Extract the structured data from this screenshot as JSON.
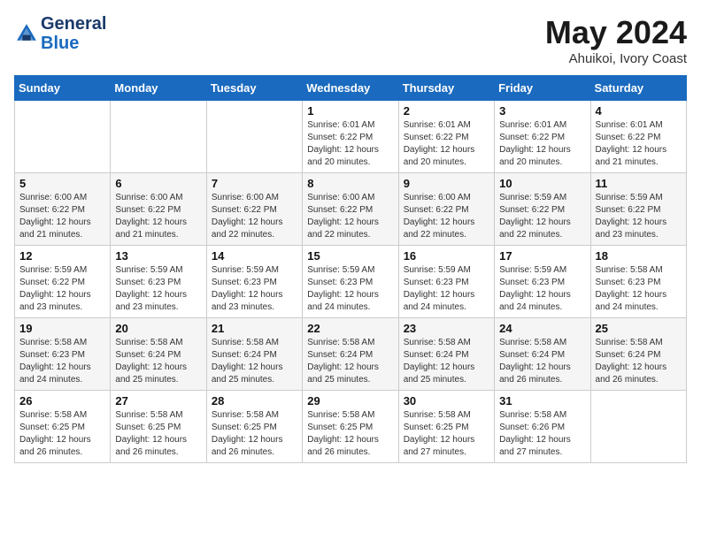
{
  "header": {
    "logo_line1": "General",
    "logo_line2": "Blue",
    "month_title": "May 2024",
    "location": "Ahuikoi, Ivory Coast"
  },
  "weekdays": [
    "Sunday",
    "Monday",
    "Tuesday",
    "Wednesday",
    "Thursday",
    "Friday",
    "Saturday"
  ],
  "weeks": [
    [
      {
        "day": "",
        "info": ""
      },
      {
        "day": "",
        "info": ""
      },
      {
        "day": "",
        "info": ""
      },
      {
        "day": "1",
        "info": "Sunrise: 6:01 AM\nSunset: 6:22 PM\nDaylight: 12 hours\nand 20 minutes."
      },
      {
        "day": "2",
        "info": "Sunrise: 6:01 AM\nSunset: 6:22 PM\nDaylight: 12 hours\nand 20 minutes."
      },
      {
        "day": "3",
        "info": "Sunrise: 6:01 AM\nSunset: 6:22 PM\nDaylight: 12 hours\nand 20 minutes."
      },
      {
        "day": "4",
        "info": "Sunrise: 6:01 AM\nSunset: 6:22 PM\nDaylight: 12 hours\nand 21 minutes."
      }
    ],
    [
      {
        "day": "5",
        "info": "Sunrise: 6:00 AM\nSunset: 6:22 PM\nDaylight: 12 hours\nand 21 minutes."
      },
      {
        "day": "6",
        "info": "Sunrise: 6:00 AM\nSunset: 6:22 PM\nDaylight: 12 hours\nand 21 minutes."
      },
      {
        "day": "7",
        "info": "Sunrise: 6:00 AM\nSunset: 6:22 PM\nDaylight: 12 hours\nand 22 minutes."
      },
      {
        "day": "8",
        "info": "Sunrise: 6:00 AM\nSunset: 6:22 PM\nDaylight: 12 hours\nand 22 minutes."
      },
      {
        "day": "9",
        "info": "Sunrise: 6:00 AM\nSunset: 6:22 PM\nDaylight: 12 hours\nand 22 minutes."
      },
      {
        "day": "10",
        "info": "Sunrise: 5:59 AM\nSunset: 6:22 PM\nDaylight: 12 hours\nand 22 minutes."
      },
      {
        "day": "11",
        "info": "Sunrise: 5:59 AM\nSunset: 6:22 PM\nDaylight: 12 hours\nand 23 minutes."
      }
    ],
    [
      {
        "day": "12",
        "info": "Sunrise: 5:59 AM\nSunset: 6:22 PM\nDaylight: 12 hours\nand 23 minutes."
      },
      {
        "day": "13",
        "info": "Sunrise: 5:59 AM\nSunset: 6:23 PM\nDaylight: 12 hours\nand 23 minutes."
      },
      {
        "day": "14",
        "info": "Sunrise: 5:59 AM\nSunset: 6:23 PM\nDaylight: 12 hours\nand 23 minutes."
      },
      {
        "day": "15",
        "info": "Sunrise: 5:59 AM\nSunset: 6:23 PM\nDaylight: 12 hours\nand 24 minutes."
      },
      {
        "day": "16",
        "info": "Sunrise: 5:59 AM\nSunset: 6:23 PM\nDaylight: 12 hours\nand 24 minutes."
      },
      {
        "day": "17",
        "info": "Sunrise: 5:59 AM\nSunset: 6:23 PM\nDaylight: 12 hours\nand 24 minutes."
      },
      {
        "day": "18",
        "info": "Sunrise: 5:58 AM\nSunset: 6:23 PM\nDaylight: 12 hours\nand 24 minutes."
      }
    ],
    [
      {
        "day": "19",
        "info": "Sunrise: 5:58 AM\nSunset: 6:23 PM\nDaylight: 12 hours\nand 24 minutes."
      },
      {
        "day": "20",
        "info": "Sunrise: 5:58 AM\nSunset: 6:24 PM\nDaylight: 12 hours\nand 25 minutes."
      },
      {
        "day": "21",
        "info": "Sunrise: 5:58 AM\nSunset: 6:24 PM\nDaylight: 12 hours\nand 25 minutes."
      },
      {
        "day": "22",
        "info": "Sunrise: 5:58 AM\nSunset: 6:24 PM\nDaylight: 12 hours\nand 25 minutes."
      },
      {
        "day": "23",
        "info": "Sunrise: 5:58 AM\nSunset: 6:24 PM\nDaylight: 12 hours\nand 25 minutes."
      },
      {
        "day": "24",
        "info": "Sunrise: 5:58 AM\nSunset: 6:24 PM\nDaylight: 12 hours\nand 26 minutes."
      },
      {
        "day": "25",
        "info": "Sunrise: 5:58 AM\nSunset: 6:24 PM\nDaylight: 12 hours\nand 26 minutes."
      }
    ],
    [
      {
        "day": "26",
        "info": "Sunrise: 5:58 AM\nSunset: 6:25 PM\nDaylight: 12 hours\nand 26 minutes."
      },
      {
        "day": "27",
        "info": "Sunrise: 5:58 AM\nSunset: 6:25 PM\nDaylight: 12 hours\nand 26 minutes."
      },
      {
        "day": "28",
        "info": "Sunrise: 5:58 AM\nSunset: 6:25 PM\nDaylight: 12 hours\nand 26 minutes."
      },
      {
        "day": "29",
        "info": "Sunrise: 5:58 AM\nSunset: 6:25 PM\nDaylight: 12 hours\nand 26 minutes."
      },
      {
        "day": "30",
        "info": "Sunrise: 5:58 AM\nSunset: 6:25 PM\nDaylight: 12 hours\nand 27 minutes."
      },
      {
        "day": "31",
        "info": "Sunrise: 5:58 AM\nSunset: 6:26 PM\nDaylight: 12 hours\nand 27 minutes."
      },
      {
        "day": "",
        "info": ""
      }
    ]
  ]
}
